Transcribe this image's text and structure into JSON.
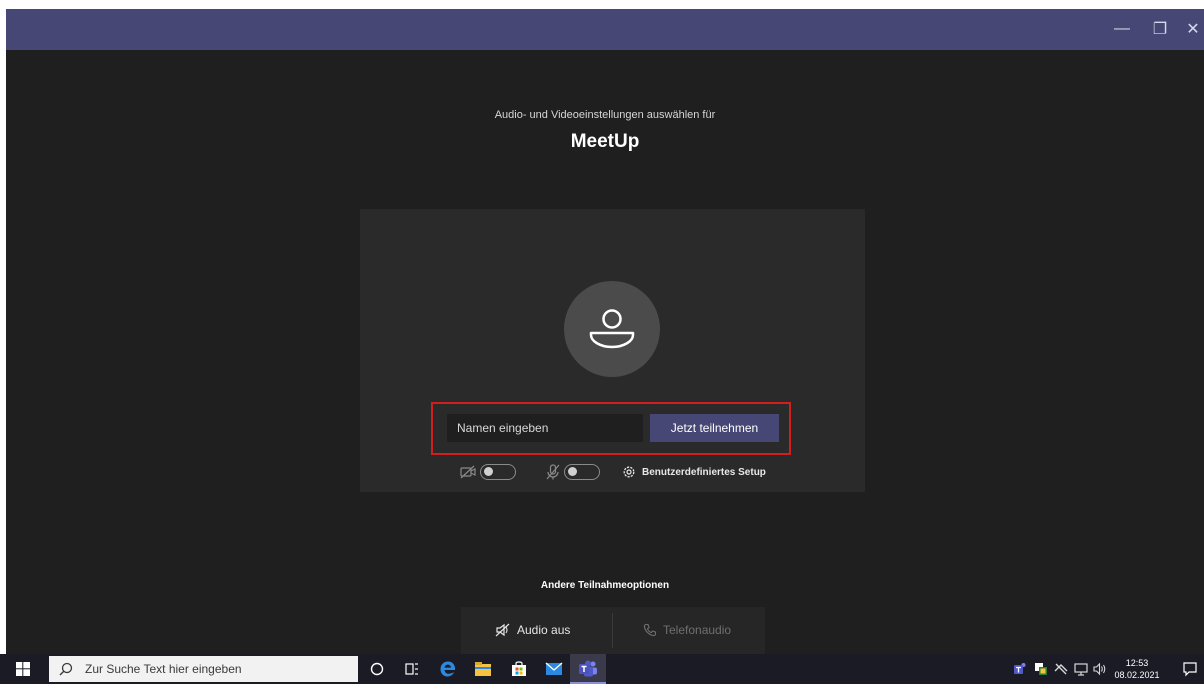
{
  "window": {
    "minimize_glyph": "—",
    "maximize_glyph": "❐",
    "close_glyph": "✕"
  },
  "prejoin": {
    "subtitle": "Audio- und Videoeinstellungen auswählen für",
    "meeting_title": "MeetUp",
    "name_placeholder": "Namen eingeben",
    "join_button": "Jetzt teilnehmen",
    "camera_toggle_on": false,
    "mic_toggle_on": false,
    "custom_setup_label": "Benutzerdefiniertes Setup"
  },
  "other_options": {
    "title": "Andere Teilnahmeoptionen",
    "audio_off": "Audio aus",
    "phone_audio": "Telefonaudio"
  },
  "taskbar": {
    "search_placeholder": "Zur Suche Text hier eingeben",
    "time": "12:53",
    "date": "08.02.2021",
    "pinned_icons": [
      "cortana-icon",
      "task-view-icon",
      "edge-icon",
      "file-explorer-icon",
      "store-icon",
      "mail-icon",
      "teams-icon"
    ],
    "tray_icons": [
      "teams-tray-icon",
      "security-icon",
      "network-muted-icon",
      "network-icon",
      "volume-icon"
    ]
  },
  "colors": {
    "titlebar": "#464775",
    "background": "#1f1f1f",
    "card": "#2b2a2b",
    "accent": "#464775",
    "highlight_border": "#d11f1f"
  }
}
